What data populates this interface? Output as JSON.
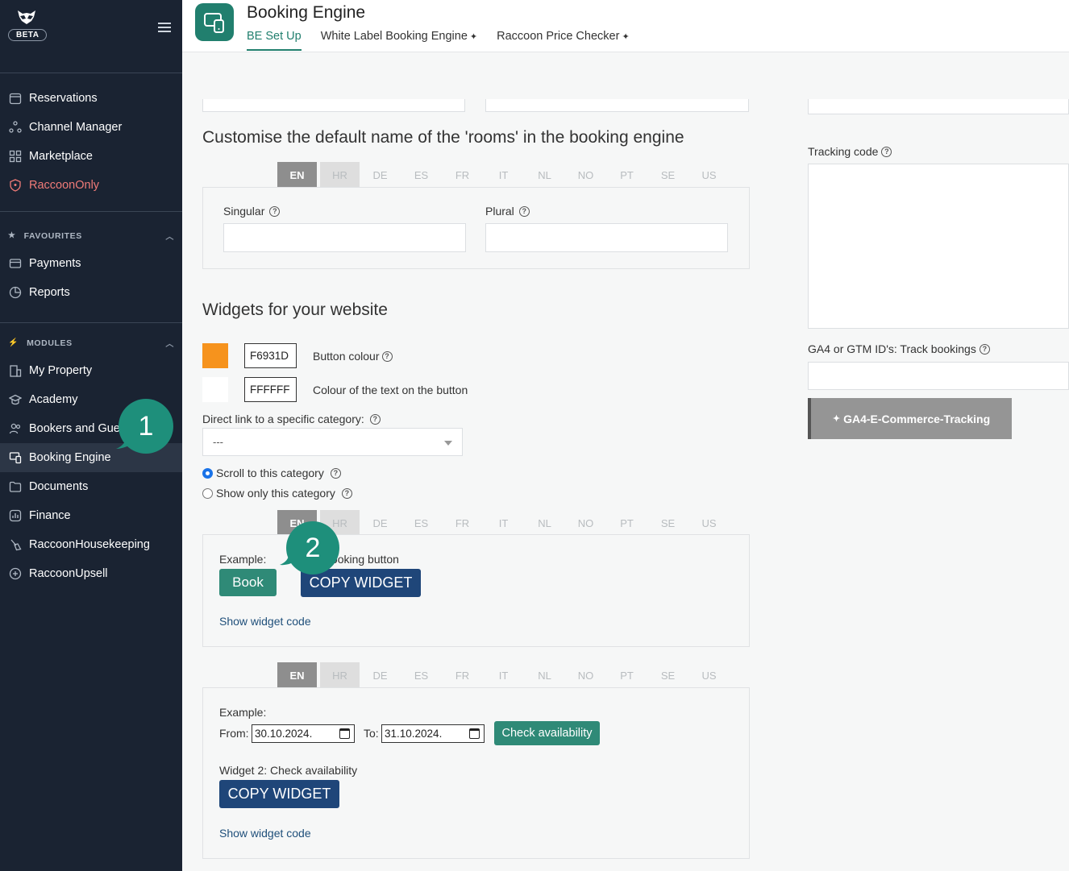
{
  "sidebar": {
    "beta": "BETA",
    "main_items": [
      {
        "label": "Reservations",
        "icon": "calendar-icon"
      },
      {
        "label": "Channel Manager",
        "icon": "network-icon"
      },
      {
        "label": "Marketplace",
        "icon": "grid-icon"
      },
      {
        "label": "RaccoonOnly",
        "icon": "shield-icon"
      }
    ],
    "favourites_title": "FAVOURITES",
    "favourites": [
      {
        "label": "Payments",
        "icon": "card-icon"
      },
      {
        "label": "Reports",
        "icon": "chart-pie-icon"
      }
    ],
    "modules_title": "MODULES",
    "modules": [
      {
        "label": "My Property",
        "icon": "building-icon"
      },
      {
        "label": "Academy",
        "icon": "graduation-icon"
      },
      {
        "label": "Bookers and Gue",
        "icon": "users-icon"
      },
      {
        "label": "Booking Engine",
        "icon": "devices-icon"
      },
      {
        "label": "Documents",
        "icon": "folder-icon"
      },
      {
        "label": "Finance",
        "icon": "bar-chart-icon"
      },
      {
        "label": "RaccoonHousekeeping",
        "icon": "broom-icon"
      },
      {
        "label": "RaccoonUpsell",
        "icon": "plus-circle-icon"
      }
    ]
  },
  "header": {
    "title": "Booking Engine",
    "tabs": [
      {
        "label": "BE Set Up"
      },
      {
        "label": "White Label Booking Engine"
      },
      {
        "label": "Raccoon Price Checker"
      }
    ],
    "spark": "✦"
  },
  "rooms_section": {
    "title": "Customise the default name of the 'rooms' in the booking engine",
    "singular_label": "Singular",
    "plural_label": "Plural"
  },
  "languages": [
    "EN",
    "HR",
    "DE",
    "ES",
    "FR",
    "IT",
    "NL",
    "NO",
    "PT",
    "SE",
    "US"
  ],
  "widgets": {
    "title": "Widgets for your website",
    "button_colour": {
      "hex": "F6931D",
      "label": "Button colour",
      "color": "#F6931D"
    },
    "text_colour": {
      "hex": "FFFFFF",
      "label": "Colour of the text on the button",
      "color": "#FFFFFF"
    },
    "direct_link_label": "Direct link to a specific category:",
    "category_value": "---",
    "radio_scroll": "Scroll to this category",
    "radio_show_only": "Show only this category"
  },
  "widget1": {
    "example_label": "Example:",
    "title": "1: Booking button",
    "book_label": "Book",
    "copy_label": "COPY WIDGET",
    "show_code": "Show widget code"
  },
  "widget2": {
    "example_label": "Example:",
    "from_label": "From:",
    "from_value": "30.10.2024.",
    "to_label": "To:",
    "to_value": "31.10.2024.",
    "check_label": "Check availability",
    "title": "Widget 2: Check availability",
    "copy_label": "COPY WIDGET",
    "show_code": "Show widget code"
  },
  "right_panel": {
    "tracking_label": "Tracking code",
    "ga_label": "GA4 or GTM ID's: Track bookings",
    "ga_button": "GA4-E-Commerce-Tracking"
  },
  "callouts": [
    "1",
    "2"
  ],
  "colors": {
    "accent": "#217f6e",
    "sidebar": "#1a2332",
    "navy": "#1f4679",
    "red": "#f07b78"
  }
}
